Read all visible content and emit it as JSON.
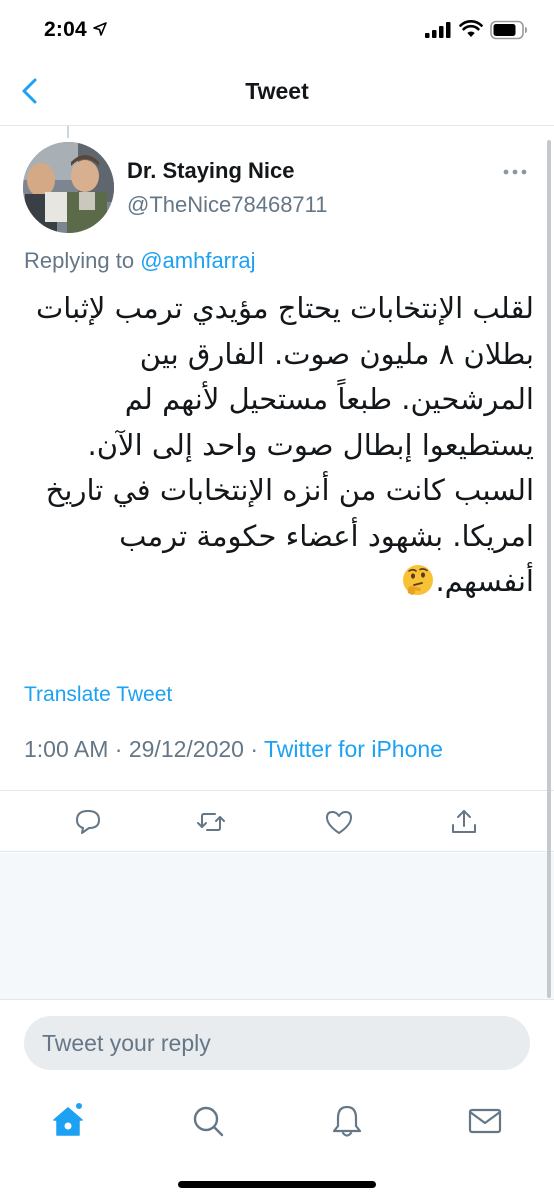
{
  "status_bar": {
    "time": "2:04"
  },
  "nav": {
    "title": "Tweet"
  },
  "tweet": {
    "author_name": "Dr. Staying Nice",
    "author_handle": "@TheNice78468711",
    "replying_prefix": "Replying to",
    "replying_to": "@amhfarraj",
    "text": "لقلب الإنتخابات يحتاج مؤيدي ترمب لإثبات بطلان ٨ مليون صوت. الفارق بين المرشحين. طبعاً مستحيل لأنهم لم يستطيعوا إبطال صوت واحد إلى الآن. السبب كانت من أنزه الإنتخابات في تاريخ امريكا. بشهود أعضاء حكومة ترمب أنفسهم.",
    "emoji": "thinking-face",
    "translate_label": "Translate Tweet",
    "time": "1:00 AM",
    "separator": " · ",
    "date": "29/12/2020",
    "source": "Twitter for iPhone"
  },
  "reply": {
    "placeholder": "Tweet your reply"
  },
  "icons": {
    "back": "chevron-left-icon",
    "more": "more-dots-icon",
    "reply": "comment-icon",
    "retweet": "retweet-icon",
    "like": "heart-icon",
    "share": "share-icon",
    "home": "home-icon",
    "search": "search-icon",
    "notifications": "bell-icon",
    "messages": "mail-icon"
  },
  "colors": {
    "accent": "#1da1f2",
    "text": "#14171a",
    "secondary": "#657786",
    "border": "#e1e8ed",
    "background_gray": "#f5f8fa"
  }
}
